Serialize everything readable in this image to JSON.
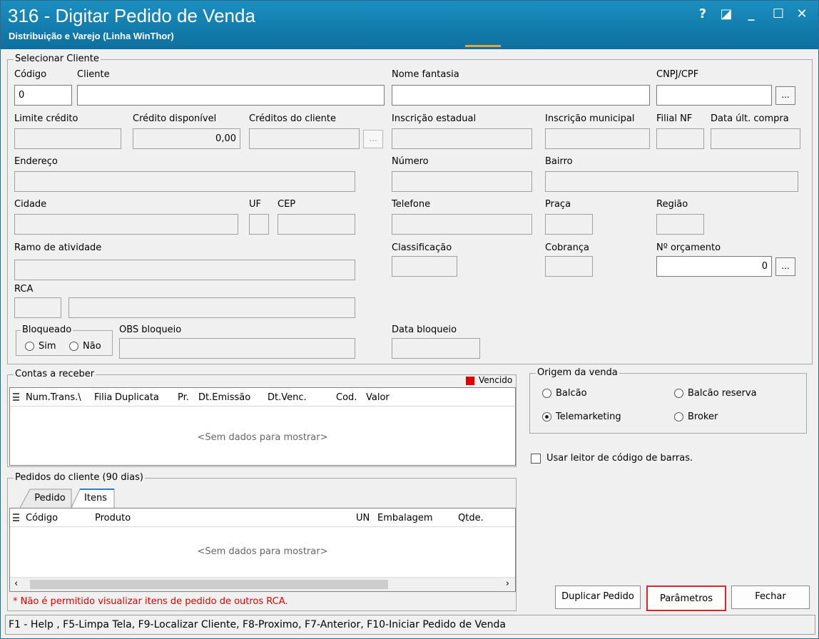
{
  "window": {
    "title": "316 - Digitar Pedido de Venda",
    "subtitle": "Distribuição e Varejo (Linha WinThor)",
    "controls": {
      "help": "?",
      "restore": "◪",
      "minimize": "_",
      "maximize": "☐",
      "close": "✕"
    }
  },
  "selecionar_cliente": {
    "group_title": "Selecionar Cliente",
    "labels": {
      "codigo": "Código",
      "cliente": "Cliente",
      "nome_fantasia": "Nome fantasia",
      "cnpj_cpf": "CNPJ/CPF",
      "limite_credito": "Limite crédito",
      "credito_disponivel": "Crédito disponível",
      "creditos_cliente": "Créditos do cliente",
      "inscricao_estadual": "Inscrição estadual",
      "inscricao_municipal": "Inscrição municipal",
      "filial_nf": "Filial NF",
      "data_ult_compra": "Data últ. compra",
      "endereco": "Endereço",
      "numero": "Número",
      "bairro": "Bairro",
      "cidade": "Cidade",
      "uf": "UF",
      "cep": "CEP",
      "telefone": "Telefone",
      "praca": "Praça",
      "regiao": "Região",
      "ramo_atividade": "Ramo de atividade",
      "classificacao": "Classificação",
      "cobranca": "Cobrança",
      "n_orcamento": "Nº orçamento",
      "rca": "RCA",
      "obs_bloqueio": "OBS bloqueio",
      "data_bloqueio": "Data bloqueio"
    },
    "values": {
      "codigo": "0",
      "credito_disponivel": "0,00",
      "n_orcamento": "0"
    },
    "ellipsis": "...",
    "bloqueado": {
      "title": "Bloqueado",
      "sim": "Sim",
      "nao": "Não"
    }
  },
  "contas_receber": {
    "group_title": "Contas a receber",
    "legend": "Vencido",
    "legend_color": "#e00000",
    "columns": [
      "Num.Trans.\\",
      "Filia",
      "Duplicata",
      "Pr.",
      "Dt.Emissão",
      "Dt.Venc.",
      "Cod.",
      "Valor"
    ],
    "empty": "<Sem dados para mostrar>"
  },
  "origem_venda": {
    "group_title": "Origem da venda",
    "options": {
      "balcao": "Balcão",
      "balcao_reserva": "Balcão reserva",
      "telemarketing": "Telemarketing",
      "broker": "Broker"
    },
    "selected": "Telemarketing"
  },
  "leitor": {
    "label": "Usar leitor de código de barras."
  },
  "pedidos_cliente": {
    "group_title": "Pedidos do cliente (90 dias)",
    "tabs": [
      "Pedido",
      "Itens"
    ],
    "active_tab": "Itens",
    "columns": [
      "Código",
      "Produto",
      "UN",
      "Embalagem",
      "Qtde."
    ],
    "empty": "<Sem dados para mostrar>",
    "warning": "* Não é permitido visualizar itens de pedido de outros RCA.",
    "warning_color": "#e00000"
  },
  "buttons": {
    "duplicar": "Duplicar Pedido",
    "parametros": "Parâmetros",
    "fechar": "Fechar"
  },
  "status_bar": "F1 - Help , F5-Limpa Tela, F9-Localizar Cliente, F8-Proximo, F7-Anterior, F10-Iniciar Pedido de Venda",
  "colors": {
    "titlebar": "#1283b5",
    "accent": "#e8a33a",
    "highlight_border": "#d9262a"
  }
}
